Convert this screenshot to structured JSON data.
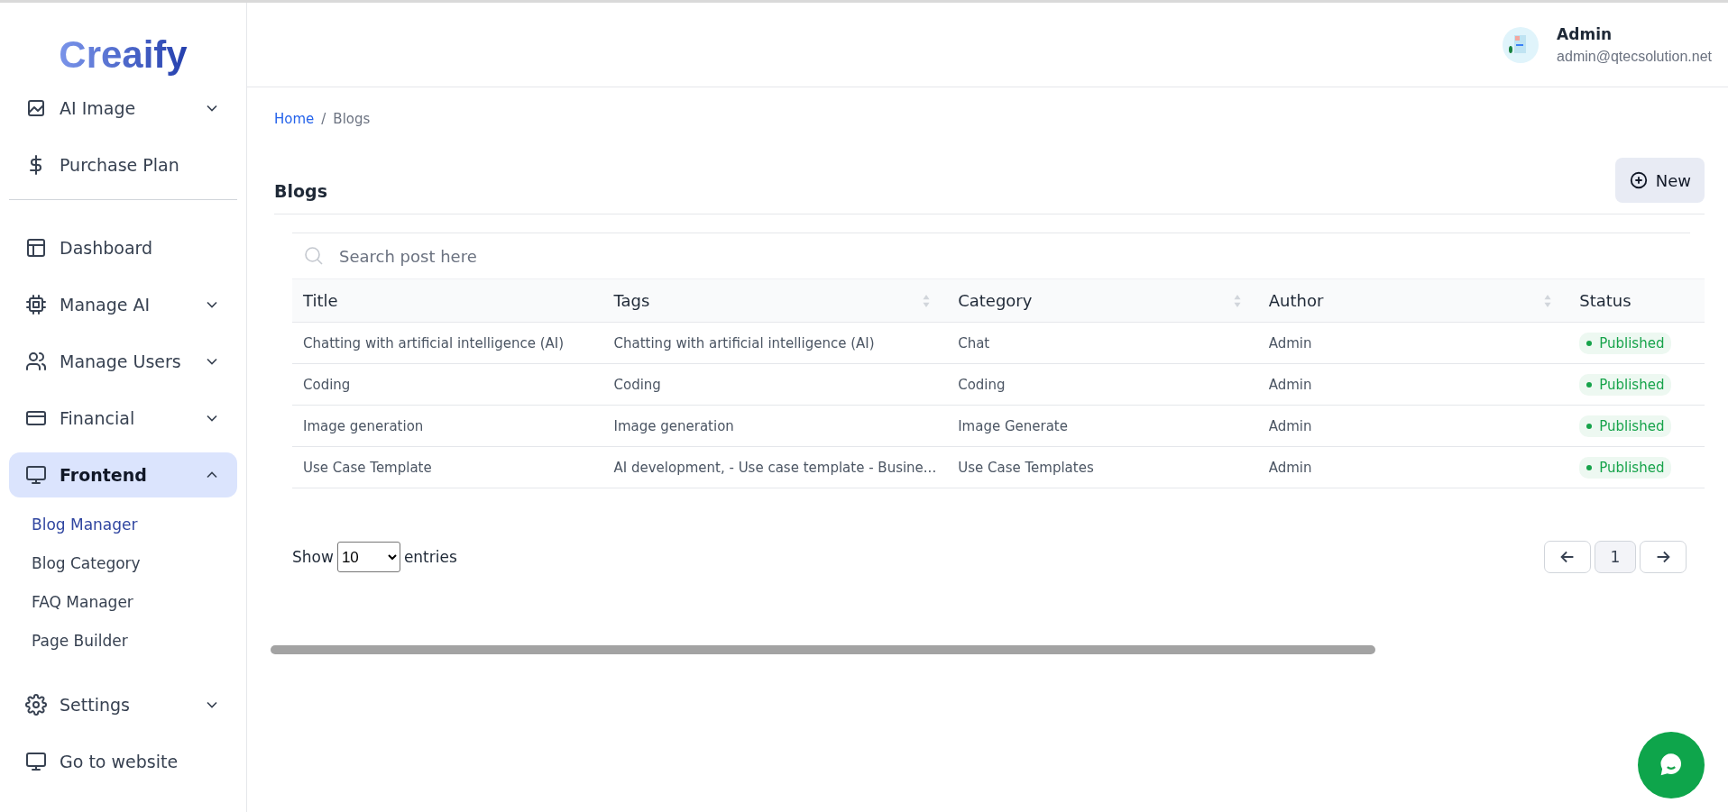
{
  "sidebar": {
    "logo": "Creaify",
    "top_items": [
      {
        "label": "AI Image",
        "has_caret": true
      },
      {
        "label": "Purchase Plan",
        "has_caret": false
      }
    ],
    "items": [
      {
        "label": "Dashboard",
        "has_caret": false,
        "expanded": false,
        "selected": false
      },
      {
        "label": "Manage AI",
        "has_caret": true,
        "expanded": false,
        "selected": false
      },
      {
        "label": "Manage Users",
        "has_caret": true,
        "expanded": false,
        "selected": false
      },
      {
        "label": "Financial",
        "has_caret": true,
        "expanded": false,
        "selected": false
      },
      {
        "label": "Frontend",
        "has_caret": true,
        "expanded": true,
        "selected": true,
        "children": [
          {
            "label": "Blog Manager",
            "selected": true
          },
          {
            "label": "Blog Category",
            "selected": false
          },
          {
            "label": "FAQ Manager",
            "selected": false
          },
          {
            "label": "Page Builder",
            "selected": false
          }
        ]
      },
      {
        "label": "Settings",
        "has_caret": true,
        "expanded": false,
        "selected": false
      },
      {
        "label": "Go to website",
        "has_caret": false,
        "expanded": false,
        "selected": false
      }
    ]
  },
  "header": {
    "user_name": "Admin",
    "user_email": "admin@qtecsolution.net"
  },
  "breadcrumb": {
    "items": [
      "Home",
      "Blogs"
    ],
    "separator": "/"
  },
  "page_title": "Blogs",
  "new_button": "New",
  "search": {
    "placeholder": "Search post here"
  },
  "table": {
    "columns": [
      {
        "label": "Title",
        "sortable": false
      },
      {
        "label": "Tags",
        "sortable": true
      },
      {
        "label": "Category",
        "sortable": true
      },
      {
        "label": "Author",
        "sortable": true
      },
      {
        "label": "Status",
        "sortable": false
      }
    ],
    "rows": [
      {
        "title": "Chatting with artificial intelligence (AI)",
        "tags": "Chatting with artificial intelligence (AI)",
        "category": "Chat",
        "author": "Admin",
        "status": "Published",
        "color": "#16a34a"
      },
      {
        "title": "Coding",
        "tags": "Coding",
        "category": "Coding",
        "author": "Admin",
        "status": "Published",
        "color": "#16a34a"
      },
      {
        "title": "Image generation",
        "tags": "Image generation",
        "category": "Image Generate",
        "author": "Admin",
        "status": "Published",
        "color": "#16a34a"
      },
      {
        "title": "Use Case Template",
        "tags": "AI development, - Use case template - Busine...",
        "category": "Use Case Templates",
        "author": "Admin",
        "status": "Published",
        "color": "#16a34a"
      }
    ]
  },
  "entries": {
    "before": "Show",
    "value": "10",
    "after": "entries"
  },
  "pagination": {
    "pages": [
      {
        "label": "1",
        "selected": true
      }
    ]
  }
}
